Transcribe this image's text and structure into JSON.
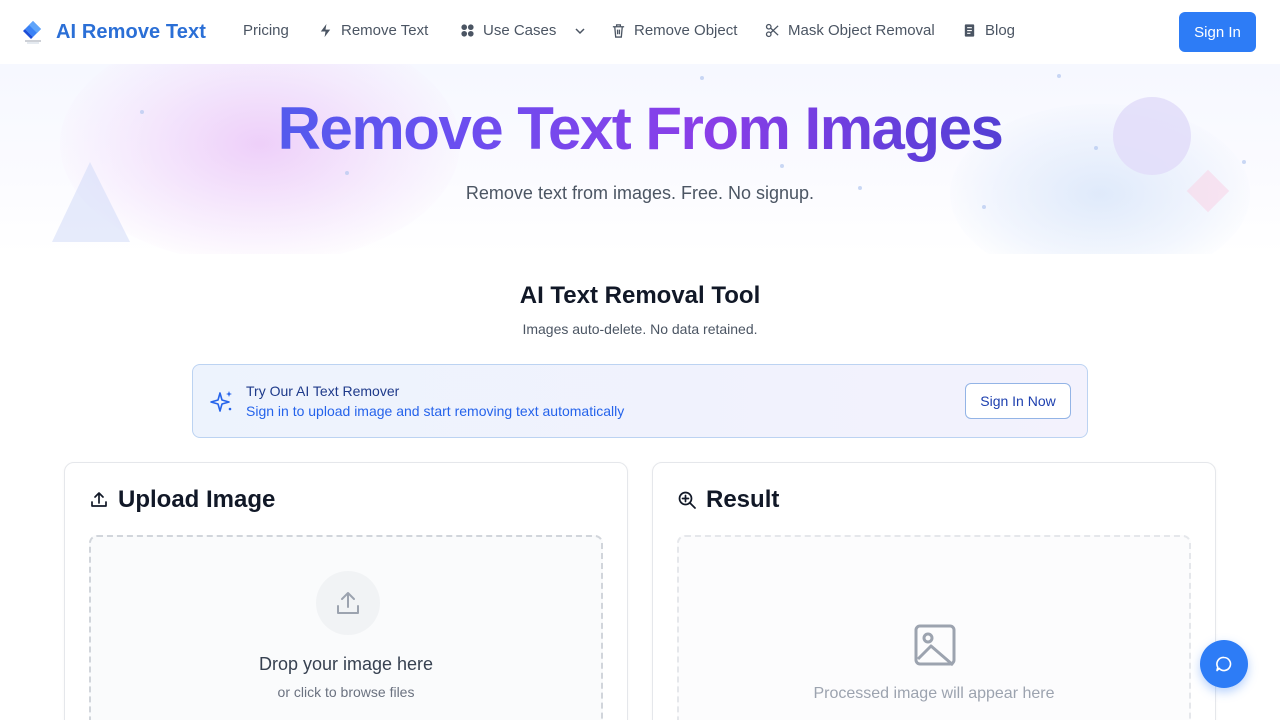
{
  "nav": {
    "brand": "AI Remove Text",
    "items": [
      {
        "label": "Pricing",
        "icon": ""
      },
      {
        "label": "Remove Text",
        "icon": "lightning-icon"
      },
      {
        "label": "Use Cases",
        "icon": "grid-icon"
      },
      {
        "label": "Remove Object",
        "icon": "trash-icon"
      },
      {
        "label": "Mask Object Removal",
        "icon": "scissors-icon"
      },
      {
        "label": "Blog",
        "icon": "document-icon"
      }
    ],
    "signin": "Sign In"
  },
  "hero": {
    "title": "Remove Text From Images",
    "subtitle": "Remove text from images. Free. No signup."
  },
  "tool": {
    "title": "AI Text Removal Tool",
    "subtitle": "Images auto-delete. No data retained."
  },
  "banner": {
    "title": "Try Our AI Text Remover",
    "text": "Sign in to upload image and start removing text automatically",
    "button": "Sign In Now"
  },
  "upload": {
    "title": "Upload Image",
    "drop_text": "Drop your image here",
    "browse_text": "or click to browse files"
  },
  "result": {
    "title": "Result",
    "placeholder": "Processed image will appear here"
  },
  "colors": {
    "brand": "#2b6fd6",
    "primary": "#2d7cf6",
    "banner_border": "#bcd3f2"
  }
}
